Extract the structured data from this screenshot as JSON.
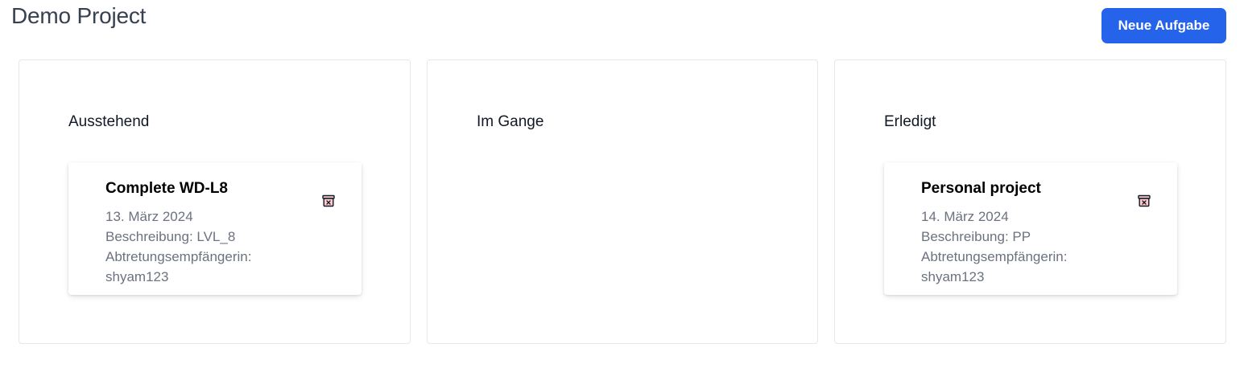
{
  "header": {
    "title": "Demo Project",
    "new_task_label": "Neue Aufgabe"
  },
  "columns": [
    {
      "title": "Ausstehend",
      "tasks": [
        {
          "title": "Complete WD-L8",
          "date": "13. März 2024",
          "description": "Beschreibung: LVL_8",
          "assignee_label": "Abtretungsempfängerin:",
          "assignee": "shyam123",
          "delete_icon": "trash-archive-icon"
        }
      ]
    },
    {
      "title": "Im Gange",
      "tasks": []
    },
    {
      "title": "Erledigt",
      "tasks": [
        {
          "title": "Personal project",
          "date": "14. März 2024",
          "description": "Beschreibung: PP",
          "assignee_label": "Abtretungsempfängerin:",
          "assignee": "shyam123",
          "delete_icon": "trash-archive-icon"
        }
      ]
    }
  ],
  "colors": {
    "accent": "#2563eb",
    "delete_icon": "#111827",
    "delete_icon_fill": "#fecaca"
  }
}
